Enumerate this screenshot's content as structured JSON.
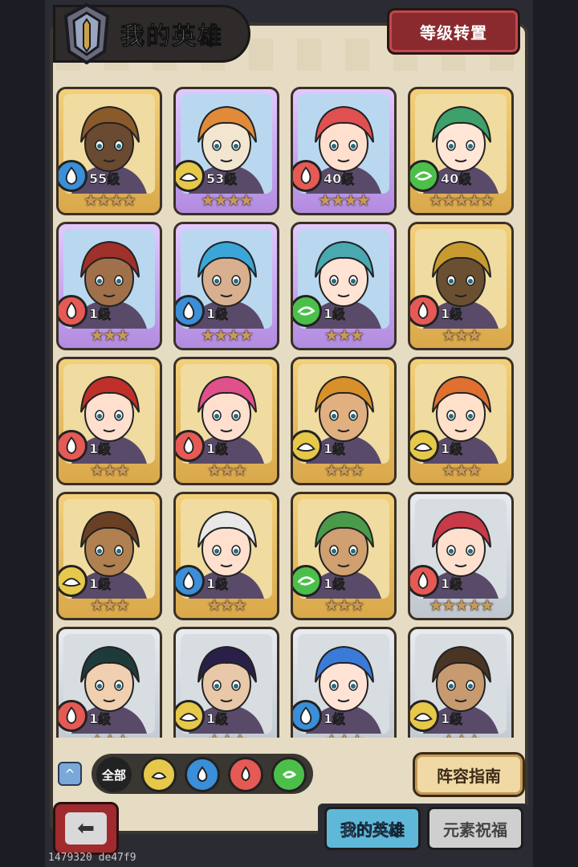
{
  "header": {
    "title": "我的英雄",
    "reset_button": "等级转置"
  },
  "colors": {
    "fire": "#e65a55",
    "water": "#3a8fd8",
    "earth": "#e6c84a",
    "wind": "#4cbf4a",
    "panel": "#e6dcc3"
  },
  "heroes": [
    {
      "level": "55级",
      "element": "water",
      "stars": "★★★★",
      "frame": "gold",
      "hair": "#8b5a2b",
      "skin": "#6a4a30"
    },
    {
      "level": "53级",
      "element": "earth",
      "stars": "★★★★",
      "frame": "purple",
      "hair": "#e08a3a",
      "skin": "#f3e6d0"
    },
    {
      "level": "40级",
      "element": "fire",
      "stars": "★★★★",
      "frame": "purple",
      "hair": "#e05050",
      "skin": "#ffe0cf"
    },
    {
      "level": "40级",
      "element": "wind",
      "stars": "★★★★★",
      "frame": "gold",
      "hair": "#3ea06a",
      "skin": "#ffe6d6"
    },
    {
      "level": "1级",
      "element": "fire",
      "stars": "★★★",
      "frame": "purple",
      "hair": "#a0302a",
      "skin": "#a0704a"
    },
    {
      "level": "1级",
      "element": "water",
      "stars": "★★★★",
      "frame": "purple",
      "hair": "#3aa6d8",
      "skin": "#d8b090"
    },
    {
      "level": "1级",
      "element": "wind",
      "stars": "★★★",
      "frame": "purple",
      "hair": "#4aa8b0",
      "skin": "#ffe4d6"
    },
    {
      "level": "1级",
      "element": "fire",
      "stars": "★★★",
      "frame": "gold",
      "hair": "#c89a30",
      "skin": "#6a5030"
    },
    {
      "level": "1级",
      "element": "fire",
      "stars": "★★★",
      "frame": "gold",
      "hair": "#c0302a",
      "skin": "#ffe0cf"
    },
    {
      "level": "1级",
      "element": "fire",
      "stars": "★★★",
      "frame": "gold",
      "hair": "#e0508a",
      "skin": "#ffe0cf"
    },
    {
      "level": "1级",
      "element": "earth",
      "stars": "★★★",
      "frame": "gold",
      "hair": "#d8902a",
      "skin": "#e0b080"
    },
    {
      "level": "1级",
      "element": "earth",
      "stars": "★★★",
      "frame": "gold",
      "hair": "#e07030",
      "skin": "#ffe0c8"
    },
    {
      "level": "1级",
      "element": "earth",
      "stars": "★★★",
      "frame": "gold",
      "hair": "#6a4024",
      "skin": "#b08050"
    },
    {
      "level": "1级",
      "element": "water",
      "stars": "★★★",
      "frame": "gold",
      "hair": "#e8e8e8",
      "skin": "#ffe0cf"
    },
    {
      "level": "1级",
      "element": "wind",
      "stars": "★★★",
      "frame": "gold",
      "hair": "#4a9a4a",
      "skin": "#d0a070"
    },
    {
      "level": "1级",
      "element": "fire",
      "stars": "★★★★★",
      "frame": "silver",
      "hair": "#c83a48",
      "skin": "#ffe0cf"
    },
    {
      "level": "1级",
      "element": "fire",
      "stars": "★★★",
      "frame": "silver",
      "hair": "#1f3a3a",
      "skin": "#f0d0b0"
    },
    {
      "level": "1级",
      "element": "earth",
      "stars": "★★★",
      "frame": "silver",
      "hair": "#2a1f48",
      "skin": "#e8c8a8"
    },
    {
      "level": "1级",
      "element": "water",
      "stars": "★★★",
      "frame": "silver",
      "hair": "#3a7ad8",
      "skin": "#ffe4d6"
    },
    {
      "level": "1级",
      "element": "earth",
      "stars": "★★★",
      "frame": "silver",
      "hair": "#4a3424",
      "skin": "#c89a70"
    }
  ],
  "filters": {
    "all_label": "全部",
    "elements": [
      "earth",
      "water",
      "fire",
      "wind"
    ]
  },
  "guide_button": "阵容指南",
  "tabs": {
    "my_heroes": "我的英雄",
    "element_blessing": "元素祝福"
  },
  "build_id": "1479320 de47f9"
}
